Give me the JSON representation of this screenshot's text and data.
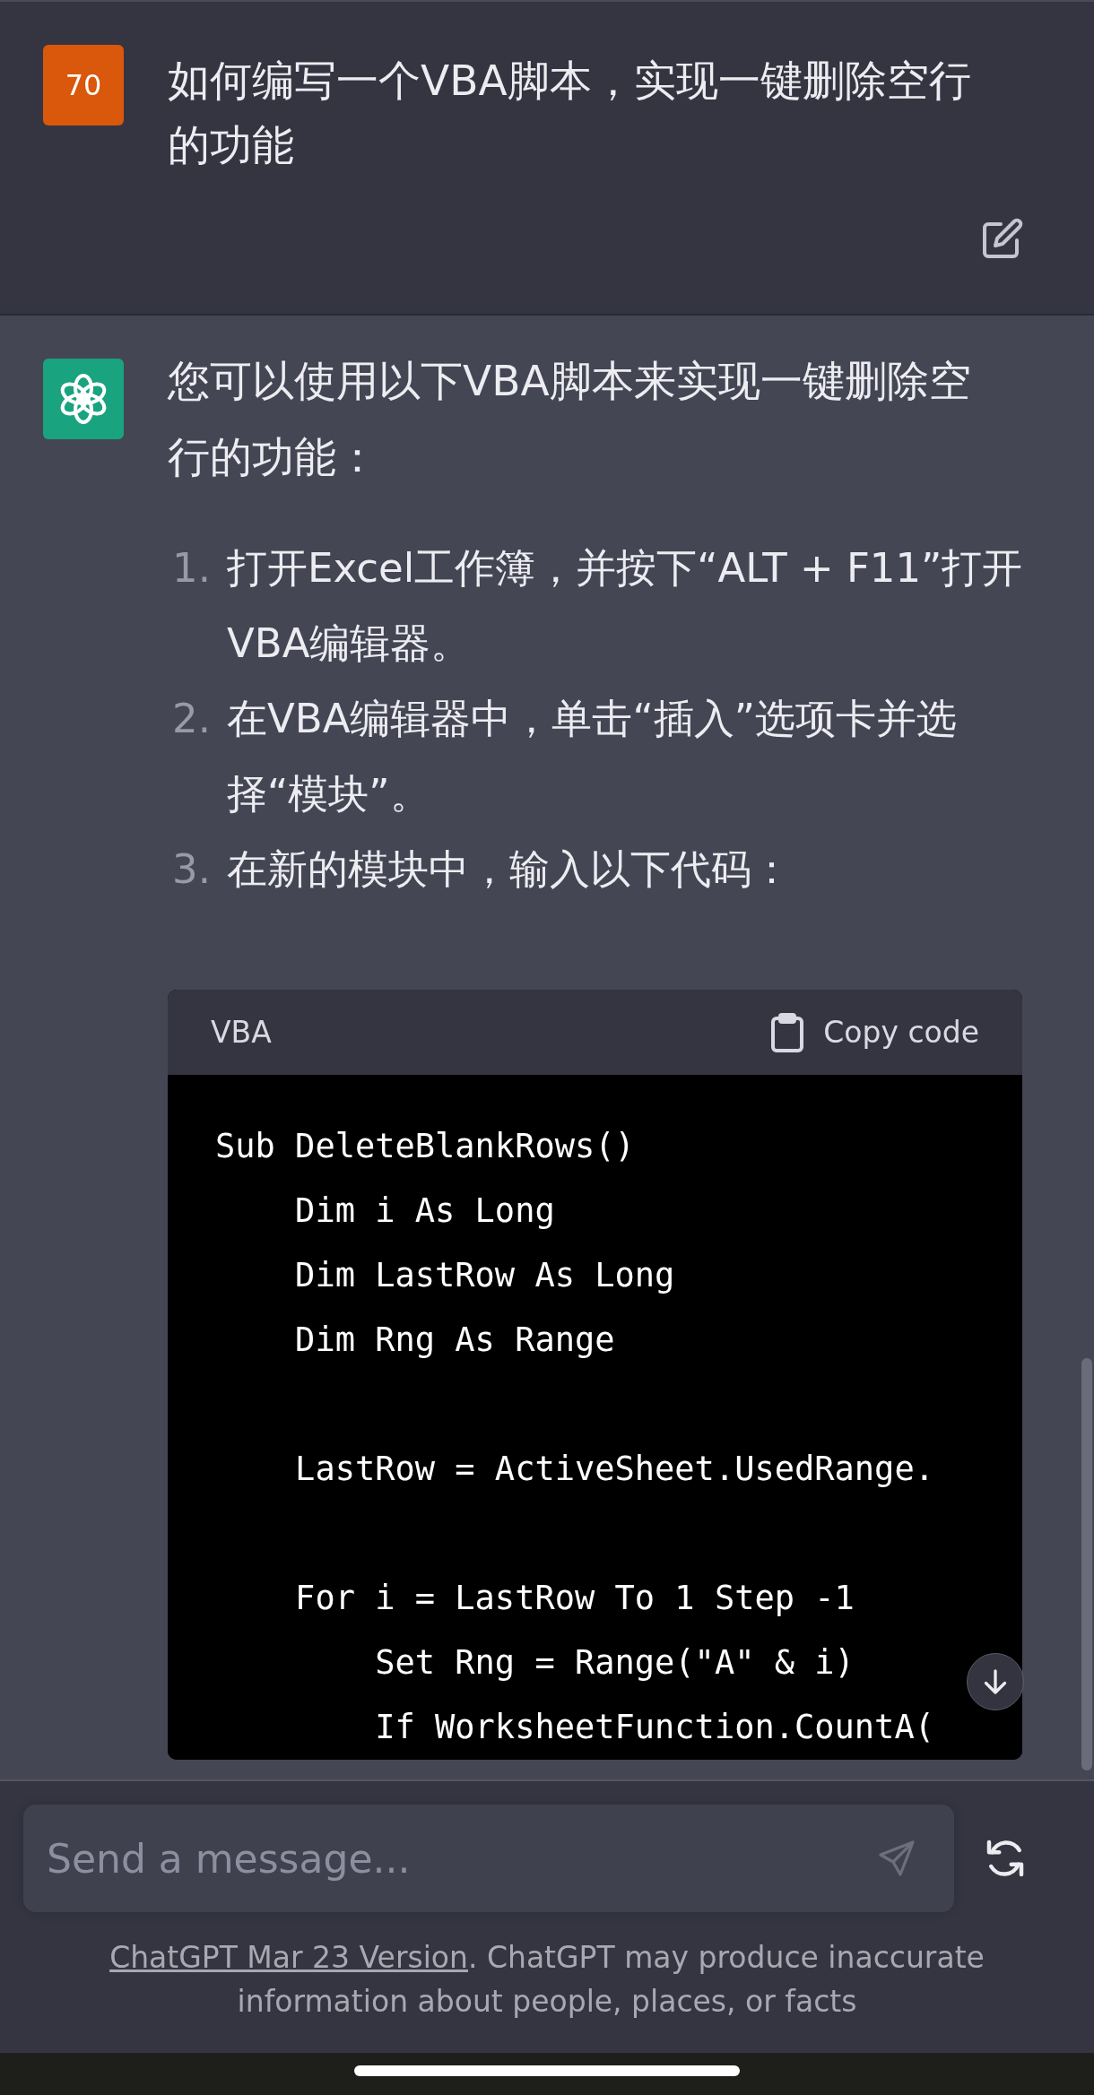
{
  "user_message": {
    "avatar": "70",
    "text": "如何编写一个VBA脚本，实现一键删除空行的功能"
  },
  "assistant_message": {
    "intro": "您可以使用以下VBA脚本来实现一键删除空行的功能：",
    "steps": [
      {
        "number": "1.",
        "text": "打开Excel工作簿，并按下“ALT + F11”打开VBA编辑器。"
      },
      {
        "number": "2.",
        "text": "在VBA编辑器中，单击“插入”选项卡并选择“模块”。"
      },
      {
        "number": "3.",
        "text": "在新的模块中，输入以下代码："
      }
    ],
    "code": {
      "language": "VBA",
      "copy_label": "Copy code",
      "paragraphs": [
        [
          "Sub DeleteBlankRows()",
          "    Dim i As Long",
          "    Dim LastRow As Long",
          "    Dim Rng As Range"
        ],
        [
          "    LastRow = ActiveSheet.UsedRange."
        ],
        [
          "    For i = LastRow To 1 Step -1",
          "        Set Rng = Range(\"A\" & i)",
          "        If WorksheetFunction.CountA("
        ]
      ]
    }
  },
  "composer": {
    "placeholder": "Send a message..."
  },
  "footer": {
    "link": "ChatGPT Mar 23 Version",
    "text": ". ChatGPT may produce inaccurate information about people, places, or facts"
  }
}
